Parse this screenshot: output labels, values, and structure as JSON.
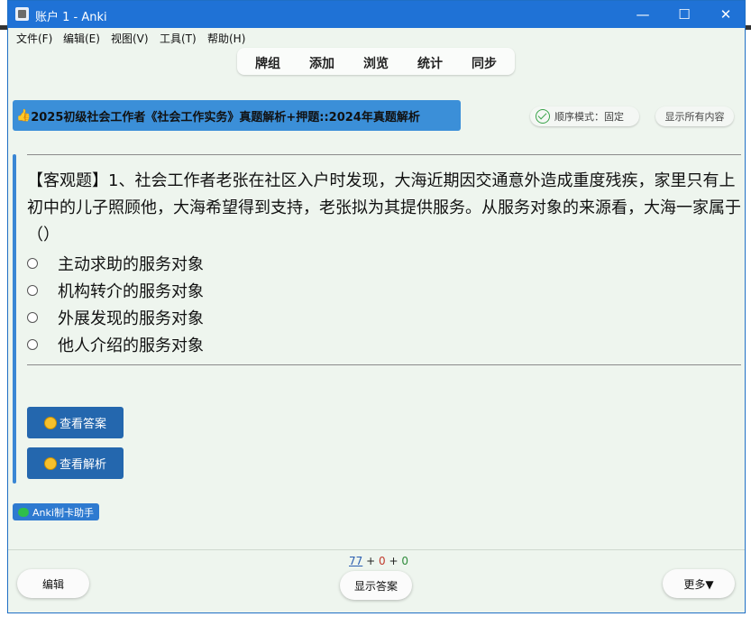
{
  "window": {
    "title": "账户 1 - Anki",
    "controls": {
      "minimize": "—",
      "maximize": "☐",
      "close": "✕"
    }
  },
  "menubar": [
    "文件(F)",
    "编辑(E)",
    "视图(V)",
    "工具(T)",
    "帮助(H)"
  ],
  "toolbar": [
    "牌组",
    "添加",
    "浏览",
    "统计",
    "同步"
  ],
  "deck_banner": {
    "emoji": "👍",
    "text": "2025初级社会工作者《社会工作实务》真题解析+押题::2024年真题解析"
  },
  "mode_pill": {
    "label": "顺序模式：固定",
    "icon": "check-circle-icon"
  },
  "show_all_button": "显示所有内容",
  "question": {
    "text": "【客观题】1、社会工作者老张在社区入户时发现，大海近期因交通意外造成重度残疾，家里只有上初中的儿子照顾他，大海希望得到支持，老张拟为其提供服务。从服务对象的来源看，大海一家属于（）",
    "options": [
      "主动求助的服务对象",
      "机构转介的服务对象",
      "外展发现的服务对象",
      "他人介绍的服务对象"
    ]
  },
  "buttons": {
    "view_answer": "查看答案",
    "view_analysis": "查看解析"
  },
  "helper_badge": "Anki制卡助手",
  "counts": {
    "new": "77",
    "learn": "0",
    "review": "0",
    "plus": "+"
  },
  "bottom": {
    "edit": "编辑",
    "show_answer": "显示答案",
    "more": "更多▼"
  },
  "colors": {
    "new": "#2a5db0",
    "learn": "#c0392b",
    "review": "#2e8b3a",
    "accent": "#2467ae"
  }
}
